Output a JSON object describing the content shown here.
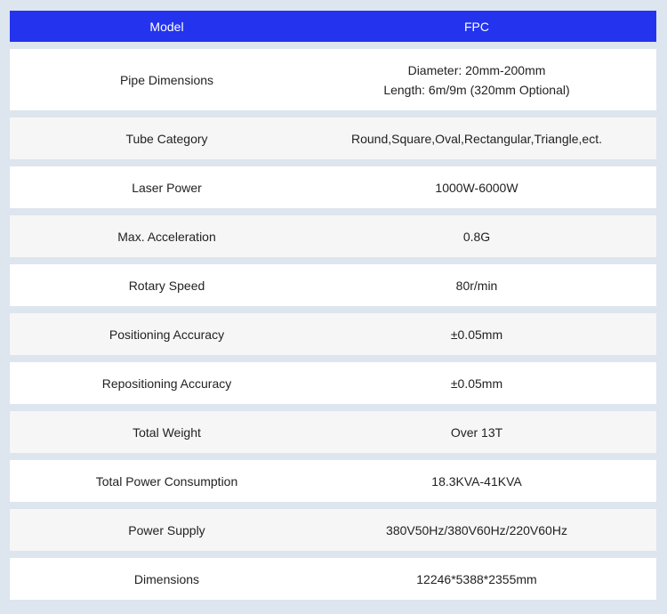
{
  "header": {
    "left": "Model",
    "right": "FPC"
  },
  "rows": [
    {
      "label": "Pipe Dimensions",
      "value_lines": [
        "Diameter: 20mm-200mm",
        "Length: 6m/9m (320mm Optional)"
      ]
    },
    {
      "label": "Tube Category",
      "value": "Round,Square,Oval,Rectangular,Triangle,ect."
    },
    {
      "label": "Laser Power",
      "value": "1000W-6000W"
    },
    {
      "label": "Max. Acceleration",
      "value": "0.8G"
    },
    {
      "label": "Rotary Speed",
      "value": "80r/min"
    },
    {
      "label": "Positioning Accuracy",
      "value": "±0.05mm"
    },
    {
      "label": "Repositioning Accuracy",
      "value": "±0.05mm"
    },
    {
      "label": "Total Weight",
      "value": "Over 13T"
    },
    {
      "label": "Total Power Consumption",
      "value": "18.3KVA-41KVA"
    },
    {
      "label": "Power Supply",
      "value": "380V50Hz/380V60Hz/220V60Hz"
    },
    {
      "label": "Dimensions",
      "value": "12246*5388*2355mm"
    }
  ],
  "colors": {
    "header_bg": "#2433ee",
    "header_text": "#ffffff",
    "row_white": "#ffffff",
    "row_grey": "#f6f6f6",
    "page_bg": "#dde5ee"
  }
}
